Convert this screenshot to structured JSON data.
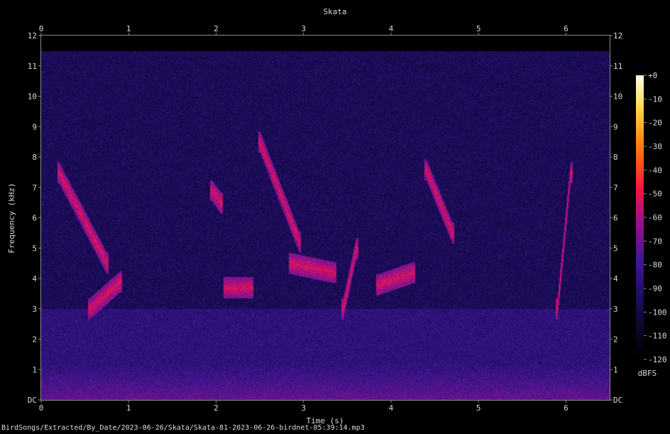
{
  "file_path": "BirdSongs/Extracted/By_Date/2023-06-26/Skata/Skata-81-2023-06-26-birdnet-05:39:14.mp3",
  "chart_data": {
    "type": "heatmap",
    "title": "Skata",
    "xlabel": "Time (s)",
    "ylabel": "Frequency (kHz)",
    "xlim": [
      0,
      6.5
    ],
    "ylim": [
      0,
      12
    ],
    "x_ticks": [
      0,
      1,
      2,
      3,
      4,
      5,
      6
    ],
    "y_ticks": [
      "DC",
      "1",
      "2",
      "3",
      "4",
      "5",
      "6",
      "7",
      "8",
      "9",
      "10",
      "11",
      "12"
    ],
    "colorbar": {
      "label": "dBFS",
      "range": [
        -120,
        0
      ],
      "ticks": [
        "+0",
        "-10",
        "-20",
        "-30",
        "-40",
        "-50",
        "-60",
        "-70",
        "-80",
        "-90",
        "-100",
        "-110",
        "-120"
      ]
    },
    "colors": {
      "background": "#000000",
      "low": "#0a0420",
      "mid": "#4a1890",
      "high": "#ff2a55",
      "peak": "#ffffe0"
    },
    "background_level_dbfs": -95,
    "low_freq_band": {
      "max_khz": 1.2,
      "level_dbfs": -72
    },
    "band_2_3khz_level_dbfs": -86,
    "calls": [
      {
        "start_s": 0.2,
        "end_s": 0.75,
        "f_start_khz": 7.5,
        "f_end_khz": 4.5
      },
      {
        "start_s": 0.55,
        "end_s": 0.9,
        "f_start_khz": 3.0,
        "f_end_khz": 3.9
      },
      {
        "start_s": 1.95,
        "end_s": 2.05,
        "f_start_khz": 6.9,
        "f_end_khz": 6.5
      },
      {
        "start_s": 2.1,
        "end_s": 2.4,
        "f_start_khz": 3.7,
        "f_end_khz": 3.7
      },
      {
        "start_s": 2.5,
        "end_s": 2.95,
        "f_start_khz": 8.5,
        "f_end_khz": 5.2
      },
      {
        "start_s": 2.85,
        "end_s": 3.35,
        "f_start_khz": 4.5,
        "f_end_khz": 4.2
      },
      {
        "start_s": 3.45,
        "end_s": 3.6,
        "f_start_khz": 3.0,
        "f_end_khz": 5.0
      },
      {
        "start_s": 3.85,
        "end_s": 4.25,
        "f_start_khz": 3.8,
        "f_end_khz": 4.2
      },
      {
        "start_s": 4.4,
        "end_s": 4.7,
        "f_start_khz": 7.6,
        "f_end_khz": 5.5
      },
      {
        "start_s": 5.9,
        "end_s": 6.05,
        "f_start_khz": 3.0,
        "f_end_khz": 7.5
      }
    ]
  }
}
